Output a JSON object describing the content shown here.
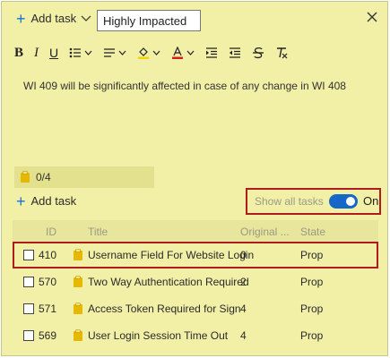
{
  "colors": {
    "card_bg": "#f2efa6",
    "accent": "#1568c7",
    "highlight_border": "#b01c1c",
    "task_icon": "#e6b800"
  },
  "header": {
    "add_task_label": "Add task",
    "title_input_value": "Highly Impacted"
  },
  "editor": {
    "text": "WI 409 will be significantly affected in case of any change in WI 408"
  },
  "checklist": {
    "counter": "0/4",
    "add_task_label": "Add task",
    "show_all_label": "Show all tasks",
    "toggle_state": "On"
  },
  "grid": {
    "columns": [
      "ID",
      "Title",
      "Original ...",
      "State"
    ],
    "rows": [
      {
        "id": "410",
        "title": "Username Field For Website Login",
        "original": "0",
        "state": "Prop"
      },
      {
        "id": "570",
        "title": "Two Way Authentication Required",
        "original": "2",
        "state": "Prop"
      },
      {
        "id": "571",
        "title": "Access Token Required for Sign",
        "original": "4",
        "state": "Prop"
      },
      {
        "id": "569",
        "title": "User Login Session Time Out",
        "original": "4",
        "state": "Prop"
      }
    ]
  }
}
